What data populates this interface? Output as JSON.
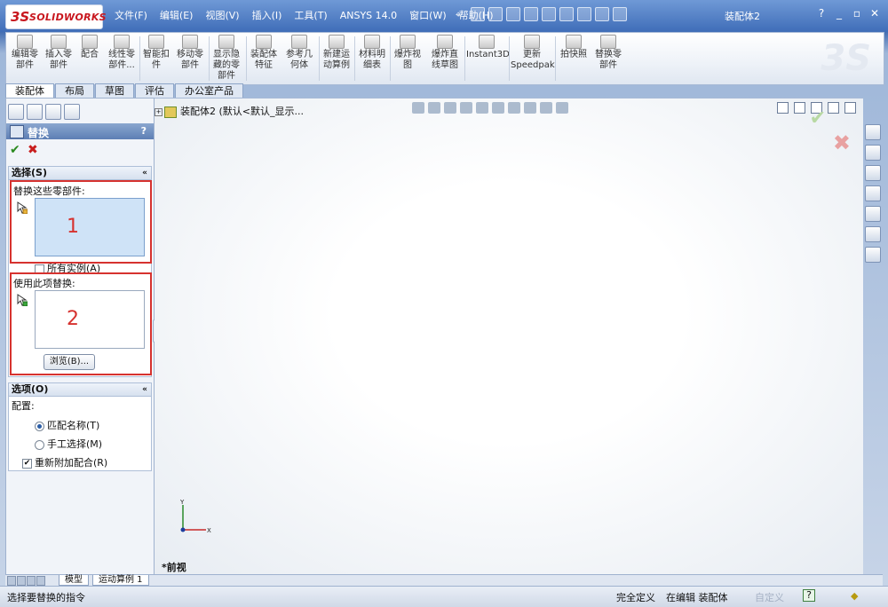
{
  "app": {
    "logo_ds": "3S",
    "logo_text": "SOLIDWORKS",
    "doc_title": "装配体2"
  },
  "menu": [
    "文件(F)",
    "编辑(E)",
    "视图(V)",
    "插入(I)",
    "工具(T)",
    "ANSYS 14.0",
    "窗口(W)",
    "帮助(H)"
  ],
  "window_controls": {
    "help": "?",
    "min": "_",
    "restore": "▫",
    "close": "✕"
  },
  "commands": [
    {
      "label": "编辑零\n部件"
    },
    {
      "label": "插入零\n部件"
    },
    {
      "label": "配合"
    },
    {
      "label": "线性零\n部件..."
    },
    {
      "label": "智能扣\n件"
    },
    {
      "label": "移动零\n部件"
    },
    {
      "label": "显示隐\n藏的零\n部件"
    },
    {
      "label": "装配体\n特征"
    },
    {
      "label": "参考几\n何体"
    },
    {
      "label": "新建运\n动算例"
    },
    {
      "label": "材料明\n细表"
    },
    {
      "label": "爆炸视\n图"
    },
    {
      "label": "爆炸直\n线草图"
    },
    {
      "label": "Instant3D"
    },
    {
      "label": "更新\nSpeedpak"
    },
    {
      "label": "拍快照"
    },
    {
      "label": "替换零\n部件"
    }
  ],
  "tabs": [
    "装配体",
    "布局",
    "草图",
    "评估",
    "办公室产品"
  ],
  "tree": {
    "root_label": "装配体2  (默认<默认_显示..."
  },
  "view_name": "*前视",
  "triad": {
    "x": "X",
    "y": "Y"
  },
  "pm": {
    "title": "替换",
    "help": "?",
    "ok": "✔",
    "cancel": "✖",
    "selection_group": "选择(S)",
    "replace_these_label": "替换这些零部件:",
    "box1_number": "1",
    "all_instances_label": "所有实例(A)",
    "replace_with_label": "使用此项替换:",
    "box2_number": "2",
    "browse_button": "浏览(B)...",
    "options_group": "选项(O)",
    "config_label": "配置:",
    "match_name_label": "匹配名称(T)",
    "manual_select_label": "手工选择(M)",
    "remate_label": "重新附加配合(R)",
    "chevron": "«"
  },
  "bottom_tabs": [
    "模型",
    "运动算例 1"
  ],
  "status": {
    "hint": "选择要替换的指令",
    "defined": "完全定义",
    "editing": "在编辑 装配体",
    "custom": "自定义",
    "help_icon": "?"
  }
}
